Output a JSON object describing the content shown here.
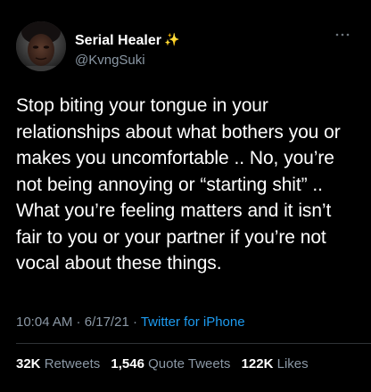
{
  "author": {
    "display_name": "Serial Healer",
    "badge": "✨",
    "handle": "@KvngSuki"
  },
  "tweet": {
    "text": "Stop biting your tongue in your relationships about what bothers you or makes you uncomfortable .. No, you’re not being annoying or “starting shit” .. What you’re feeling matters and it isn’t fair to you or your partner if you’re not vocal about these things."
  },
  "meta": {
    "time": "10:04 AM",
    "separator": " · ",
    "date": "6/17/21",
    "separator2": " · ",
    "source": "Twitter for iPhone"
  },
  "stats": {
    "retweets_count": "32K",
    "retweets_label": "Retweets",
    "quotes_count": "1,546",
    "quotes_label": "Quote Tweets",
    "likes_count": "122K",
    "likes_label": "Likes"
  },
  "icons": {
    "more": "more-horizontal-icon",
    "avatar": "avatar-photo"
  }
}
